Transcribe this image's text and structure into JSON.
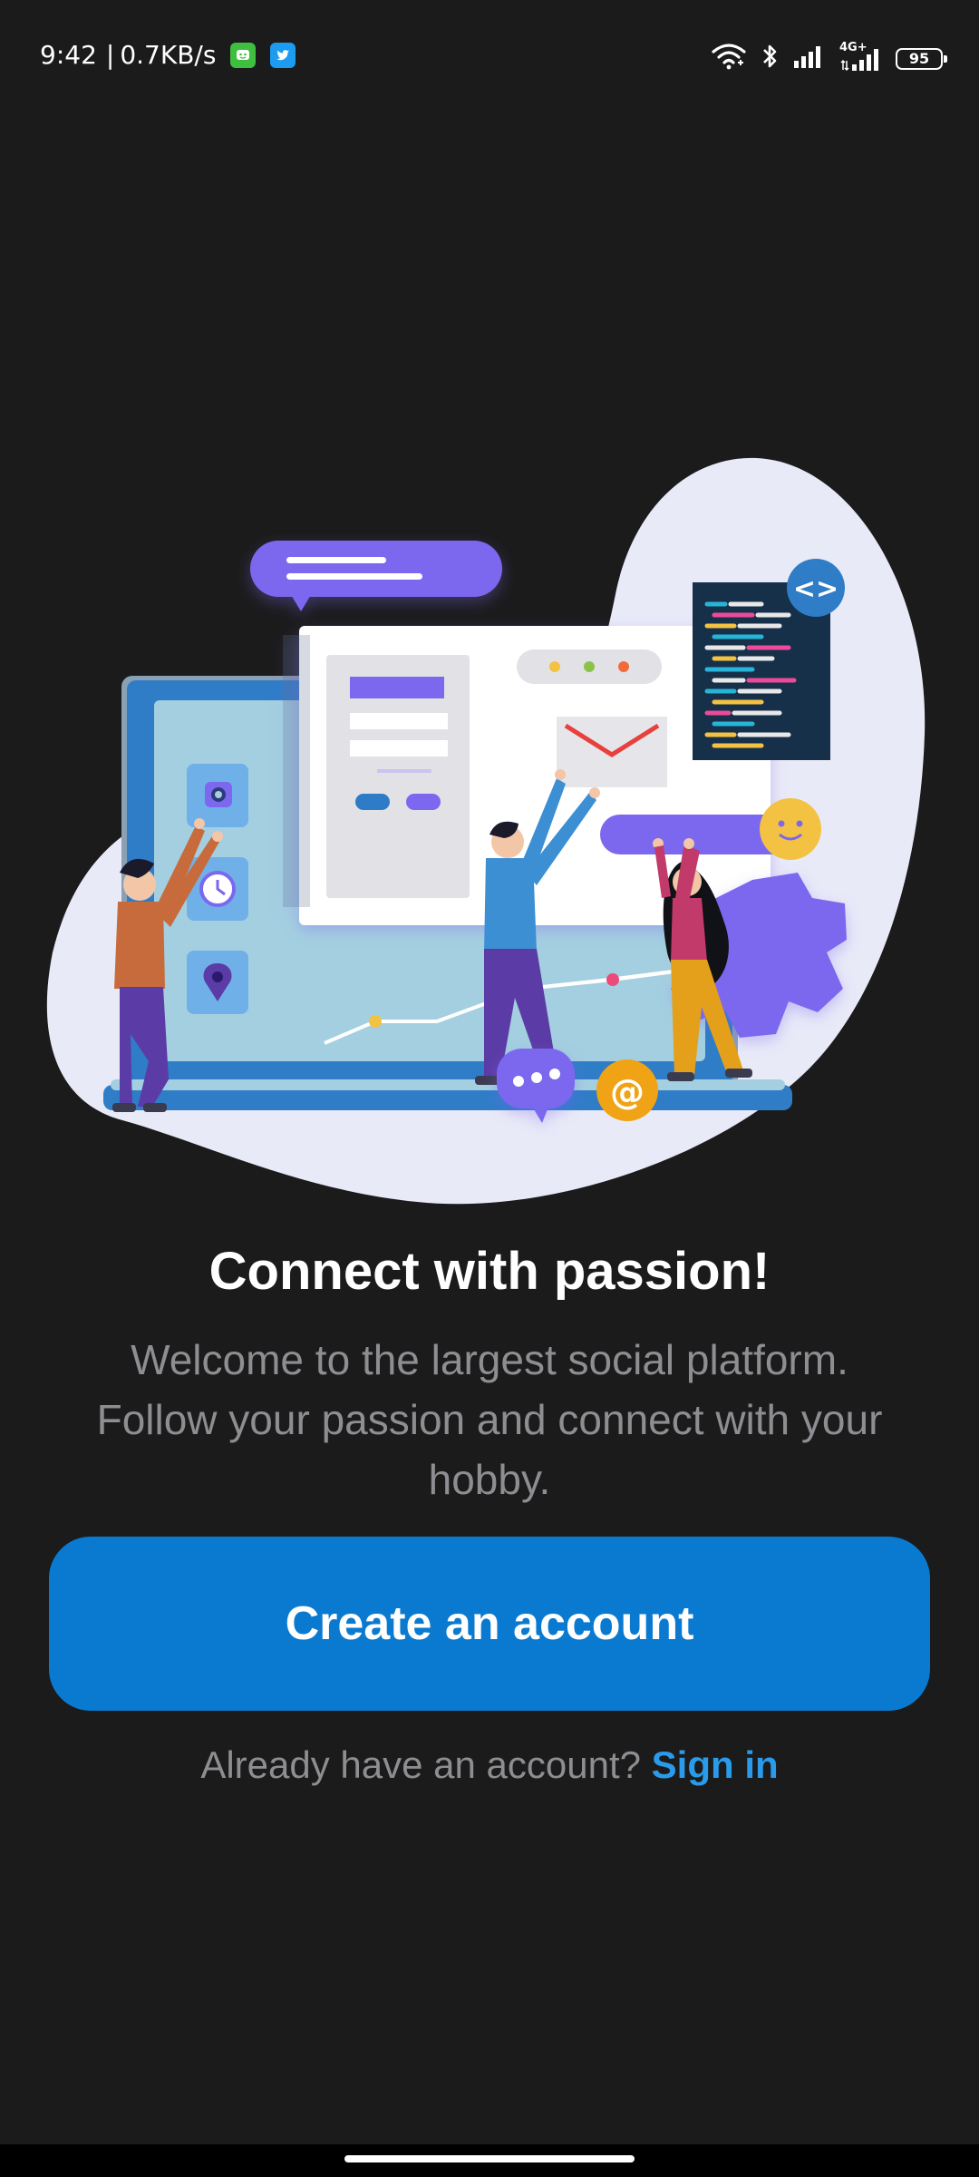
{
  "status_bar": {
    "time": "9:42",
    "separator": "|",
    "network_speed": "0.7KB/s",
    "battery_level": "95",
    "network_type": "4G+",
    "icons": [
      "wechat-icon",
      "twitter-icon",
      "wifi-icon",
      "bluetooth-icon",
      "signal-icon",
      "signal-4g-icon",
      "battery-icon"
    ]
  },
  "onboarding": {
    "headline": "Connect with passion!",
    "subtitle_line1": "Welcome to the largest social platform.",
    "subtitle_line2": "Follow your passion and connect with your",
    "subtitle_line3": "hobby.",
    "create_account_label": "Create an account",
    "signin_prompt": "Already have an account?",
    "signin_link": "Sign in"
  },
  "illustration": {
    "code_badge": "<>",
    "at_symbol": "@"
  },
  "colors": {
    "background": "#1b1b1c",
    "primary_button": "#0a7ad0",
    "link": "#2a9bea",
    "subtitle_text": "#8e8e92",
    "accent_purple": "#7b68ee"
  }
}
